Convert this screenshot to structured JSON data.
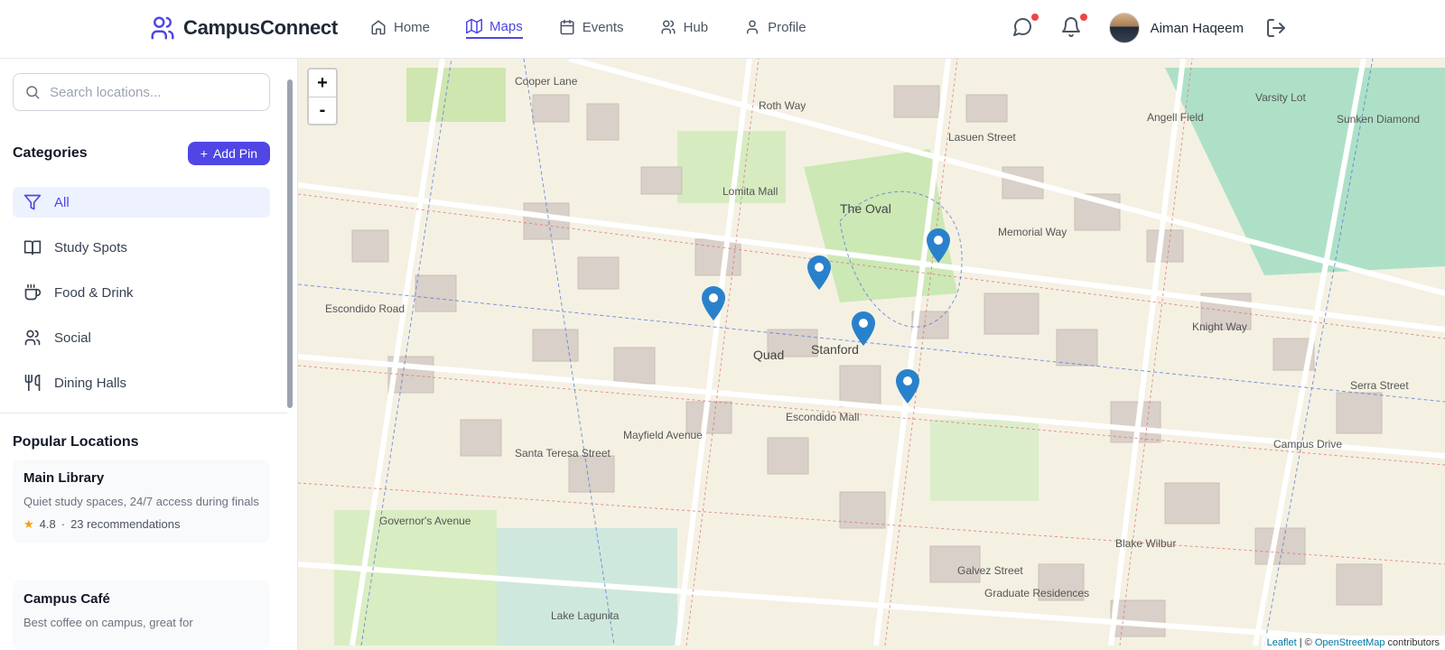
{
  "app": {
    "name": "CampusConnect"
  },
  "nav": [
    {
      "label": "Home",
      "icon": "home-icon"
    },
    {
      "label": "Maps",
      "icon": "map-icon",
      "active": true
    },
    {
      "label": "Events",
      "icon": "calendar-icon"
    },
    {
      "label": "Hub",
      "icon": "users-icon"
    },
    {
      "label": "Profile",
      "icon": "user-icon"
    }
  ],
  "user": {
    "name": "Aiman Haqeem"
  },
  "colors": {
    "accent": "#4f46e5",
    "notification": "#ef4444",
    "marker": "#2a81cb"
  },
  "sidebar": {
    "search_placeholder": "Search locations...",
    "categories_title": "Categories",
    "add_pin_label": "Add Pin",
    "categories": [
      {
        "label": "All",
        "icon": "filter-icon",
        "active": true
      },
      {
        "label": "Study Spots",
        "icon": "book-icon"
      },
      {
        "label": "Food & Drink",
        "icon": "coffee-icon"
      },
      {
        "label": "Social",
        "icon": "users-icon"
      },
      {
        "label": "Dining Halls",
        "icon": "utensils-icon"
      }
    ],
    "popular_title": "Popular Locations",
    "popular": [
      {
        "name": "Main Library",
        "description": "Quiet study spaces, 24/7 access during finals",
        "rating": "4.8",
        "recommendations": "23 recommendations"
      },
      {
        "name": "Campus Café",
        "description": "Best coffee on campus, great for"
      }
    ]
  },
  "map": {
    "zoom_in": "+",
    "zoom_out": "-",
    "attribution_leaflet": "Leaflet",
    "attribution_sep": " | © ",
    "attribution_osm": "OpenStreetMap",
    "attribution_tail": " contributors",
    "labels": {
      "oval": "The Oval",
      "stanford": "Stanford",
      "quad": "Quad",
      "angell": "Angell Field",
      "sunken": "Sunken Diamond",
      "varsity": "Varsity Lot",
      "escondido": "Escondido Mall",
      "roth": "Roth Way",
      "memorial": "Memorial Way",
      "serra": "Serra Street",
      "lomita": "Lomita Mall",
      "campus_drive": "Campus Drive",
      "lasuen": "Lasuen Street",
      "galvez": "Galvez Street",
      "mayfield": "Mayfield Avenue",
      "santa_teresa": "Santa Teresa Street",
      "governors": "Governor's Avenue",
      "escondido_road": "Escondido Road",
      "blake": "Blake Wilbur",
      "graduate": "Graduate Residences",
      "cooper": "Cooper Lane",
      "knight": "Knight Way",
      "lagunita": "Lake Lagunita"
    }
  }
}
